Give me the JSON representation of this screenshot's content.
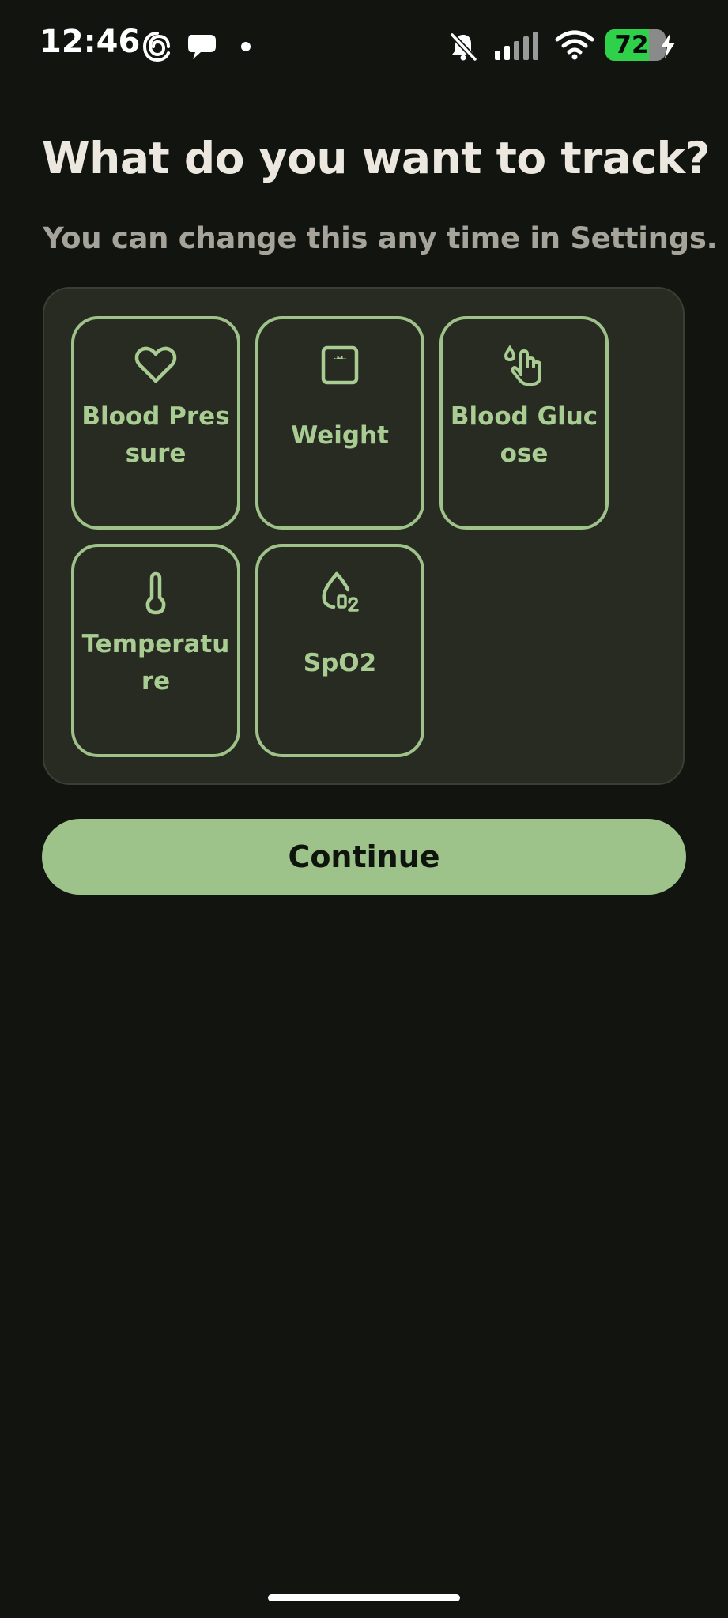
{
  "status_bar": {
    "time": "12:46",
    "battery_level": "72",
    "battery_fraction": 0.72,
    "left_icons": [
      "threads-icon",
      "chat-bubble-icon",
      "notification-dot-icon"
    ],
    "right_icons": [
      "muted-bell-icon",
      "cellular-signal-icon",
      "wifi-icon",
      "battery-icon",
      "charging-bolt-icon"
    ]
  },
  "header": {
    "title": "What do you want to track?",
    "subtitle": "You can change this any time in Settings."
  },
  "metrics": [
    {
      "label": "Blood Pressure",
      "icon": "heart-icon",
      "selected": true
    },
    {
      "label": "Weight",
      "icon": "scale-icon",
      "selected": true
    },
    {
      "label": "Blood Glucose",
      "icon": "glucose-finger-icon",
      "selected": true
    },
    {
      "label": "Temperature",
      "icon": "thermometer-icon",
      "selected": true
    },
    {
      "label": "SpO2",
      "icon": "oxygen-drop-icon",
      "selected": true
    }
  ],
  "actions": {
    "continue_label": "Continue"
  },
  "colors": {
    "background": "#121410",
    "panel": "#272b22",
    "accent": "#9dc38a",
    "title": "#ece8df",
    "subtitle": "#a5a39a"
  }
}
